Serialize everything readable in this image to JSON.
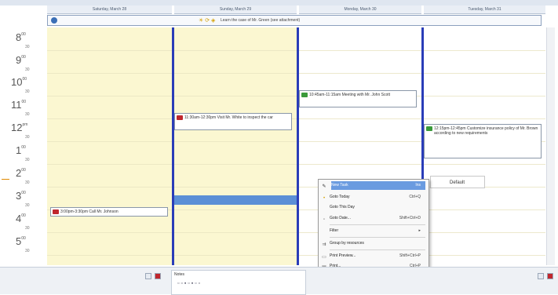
{
  "days": [
    {
      "label": "Saturday, March 28"
    },
    {
      "label": "Sunday, March 29"
    },
    {
      "label": "Monday, March 30"
    },
    {
      "label": "Tuesday, March 31"
    }
  ],
  "all_day_event": {
    "text": "Learn the case of Mr. Green (see attachment)"
  },
  "hours": [
    {
      "hour": "8",
      "min": "00",
      "half": "30"
    },
    {
      "hour": "9",
      "min": "00",
      "half": "30"
    },
    {
      "hour": "10",
      "min": "00",
      "half": "30"
    },
    {
      "hour": "11",
      "min": "00",
      "half": "30"
    },
    {
      "hour": "12",
      "min": "pm",
      "half": "30"
    },
    {
      "hour": "1",
      "min": "00",
      "half": "30"
    },
    {
      "hour": "2",
      "min": "00",
      "half": "30"
    },
    {
      "hour": "3",
      "min": "00",
      "half": "30"
    },
    {
      "hour": "4",
      "min": "00",
      "half": "30"
    },
    {
      "hour": "5",
      "min": "00",
      "half": "30"
    }
  ],
  "appointments": [
    {
      "text": "11:30am-12:30pm Visit Mr. White to inspect the car",
      "icon": "red-icon"
    },
    {
      "text": "10:45am-11:15am Meeting with Mr. John Scott",
      "icon": "green-icon"
    },
    {
      "text": "12:15pm-12:45pm Customize insurance policy of Mr. Brown according to new requirements",
      "icon": "green-icon"
    },
    {
      "text": "3:00pm-3:30pm Call Mr. Johnson",
      "icon": "red-icon"
    }
  ],
  "context_menu": {
    "items": [
      {
        "label": "New Task",
        "shortcut": "Ins"
      },
      {
        "label": "Goto Today",
        "shortcut": "Ctrl+Q"
      },
      {
        "label": "Goto This Day",
        "shortcut": ""
      },
      {
        "label": "Goto Date...",
        "shortcut": "Shift+Ctrl+D"
      },
      {
        "label": "Filter",
        "shortcut": "▸"
      },
      {
        "label": "Group by resources",
        "shortcut": ""
      },
      {
        "label": "Print Preview...",
        "shortcut": "Shift+Ctrl+P"
      },
      {
        "label": "Print...",
        "shortcut": "Ctrl+P"
      }
    ]
  },
  "default_label": "Default",
  "notes_label": "Notes",
  "colors": {
    "accent_blue": "#2a3db8",
    "highlight": "#6a9be0",
    "day_bg": "#fbf7d1"
  }
}
